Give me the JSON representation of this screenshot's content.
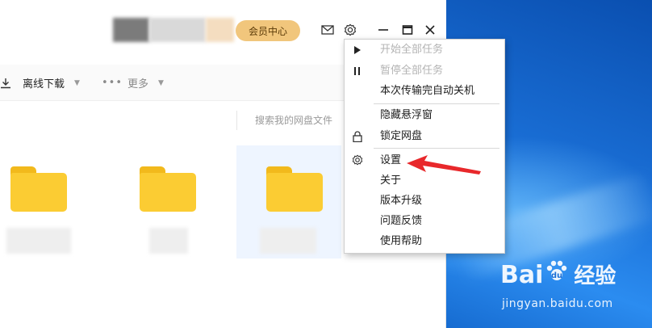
{
  "titlebar": {
    "member_label": "会员中心",
    "icons": [
      "mail-icon",
      "gear-icon"
    ],
    "window_controls": [
      "minimize-icon",
      "maximize-icon",
      "close-icon"
    ]
  },
  "toolbar": {
    "offline_download": "离线下载",
    "more": "更多"
  },
  "search": {
    "placeholder": "搜索我的网盘文件"
  },
  "menu": {
    "items": [
      {
        "label": "开始全部任务",
        "enabled": false,
        "icon": "play-icon"
      },
      {
        "label": "暂停全部任务",
        "enabled": false,
        "icon": "pause-icon"
      },
      {
        "label": "本次传输完自动关机",
        "enabled": true
      },
      {
        "label": "隐藏悬浮窗",
        "enabled": true
      },
      {
        "label": "锁定网盘",
        "enabled": true,
        "icon": "lock-icon"
      },
      {
        "label": "设置",
        "enabled": true,
        "icon": "gear-icon"
      },
      {
        "label": "关于",
        "enabled": true
      },
      {
        "label": "版本升级",
        "enabled": true
      },
      {
        "label": "问题反馈",
        "enabled": true
      },
      {
        "label": "使用帮助",
        "enabled": true
      }
    ]
  },
  "folders": [
    {
      "icon": "folder-icon",
      "selected": false
    },
    {
      "icon": "folder-icon",
      "selected": false
    },
    {
      "icon": "folder-icon",
      "selected": true
    }
  ],
  "watermark": {
    "logo_text": "Bai",
    "logo_text2": "du",
    "jingyan": "经验",
    "url": "jingyan.baidu.com"
  },
  "colors": {
    "member_bg": "#f1c67c",
    "folder": "#fbcc33",
    "arrow": "#e8282b",
    "desktop": "#1a6fd6"
  }
}
